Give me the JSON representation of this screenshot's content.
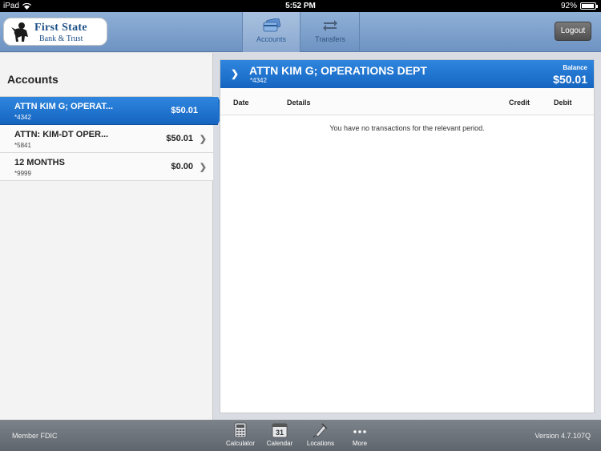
{
  "status_bar": {
    "carrier": "iPad",
    "time": "5:52 PM",
    "battery": "92%",
    "battery_level": 0.92
  },
  "header": {
    "logo": {
      "line1": "First State",
      "line2": "Bank & Trust"
    },
    "tabs": [
      {
        "label": "Accounts",
        "icon": "accounts-card-icon"
      },
      {
        "label": "Transfers",
        "icon": "transfer-arrows-icon"
      }
    ],
    "logout_label": "Logout"
  },
  "sidebar": {
    "title": "Accounts",
    "accounts": [
      {
        "name": "ATTN KIM G; OPERAT...",
        "number": "*4342",
        "amount": "$50.01"
      },
      {
        "name": "ATTN: KIM-DT OPER...",
        "number": "*5841",
        "amount": "$50.01"
      },
      {
        "name": "12 MONTHS",
        "number": "*9999",
        "amount": "$0.00"
      }
    ]
  },
  "detail": {
    "title": "ATTN KIM G; OPERATIONS DEPT",
    "number": "*4342",
    "balance_label": "Balance",
    "balance": "$50.01",
    "columns": {
      "date": "Date",
      "details": "Details",
      "credit": "Credit",
      "debit": "Debit"
    },
    "empty_message": "You have no transactions for the relevant period."
  },
  "bottom_bar": {
    "left": "Member FDIC",
    "tools": [
      {
        "label": "Calculator",
        "icon": "calculator-icon"
      },
      {
        "label": "Calendar",
        "icon": "calendar-icon",
        "day": "31"
      },
      {
        "label": "Locations",
        "icon": "locations-pin-icon"
      },
      {
        "label": "More",
        "icon": "more-dots-icon"
      }
    ],
    "version": "Version 4.7.107Q"
  },
  "colors": {
    "header_blue": "#7a9dca",
    "selected_blue": "#1e74cf",
    "bottom_gray": "#6b7178"
  }
}
